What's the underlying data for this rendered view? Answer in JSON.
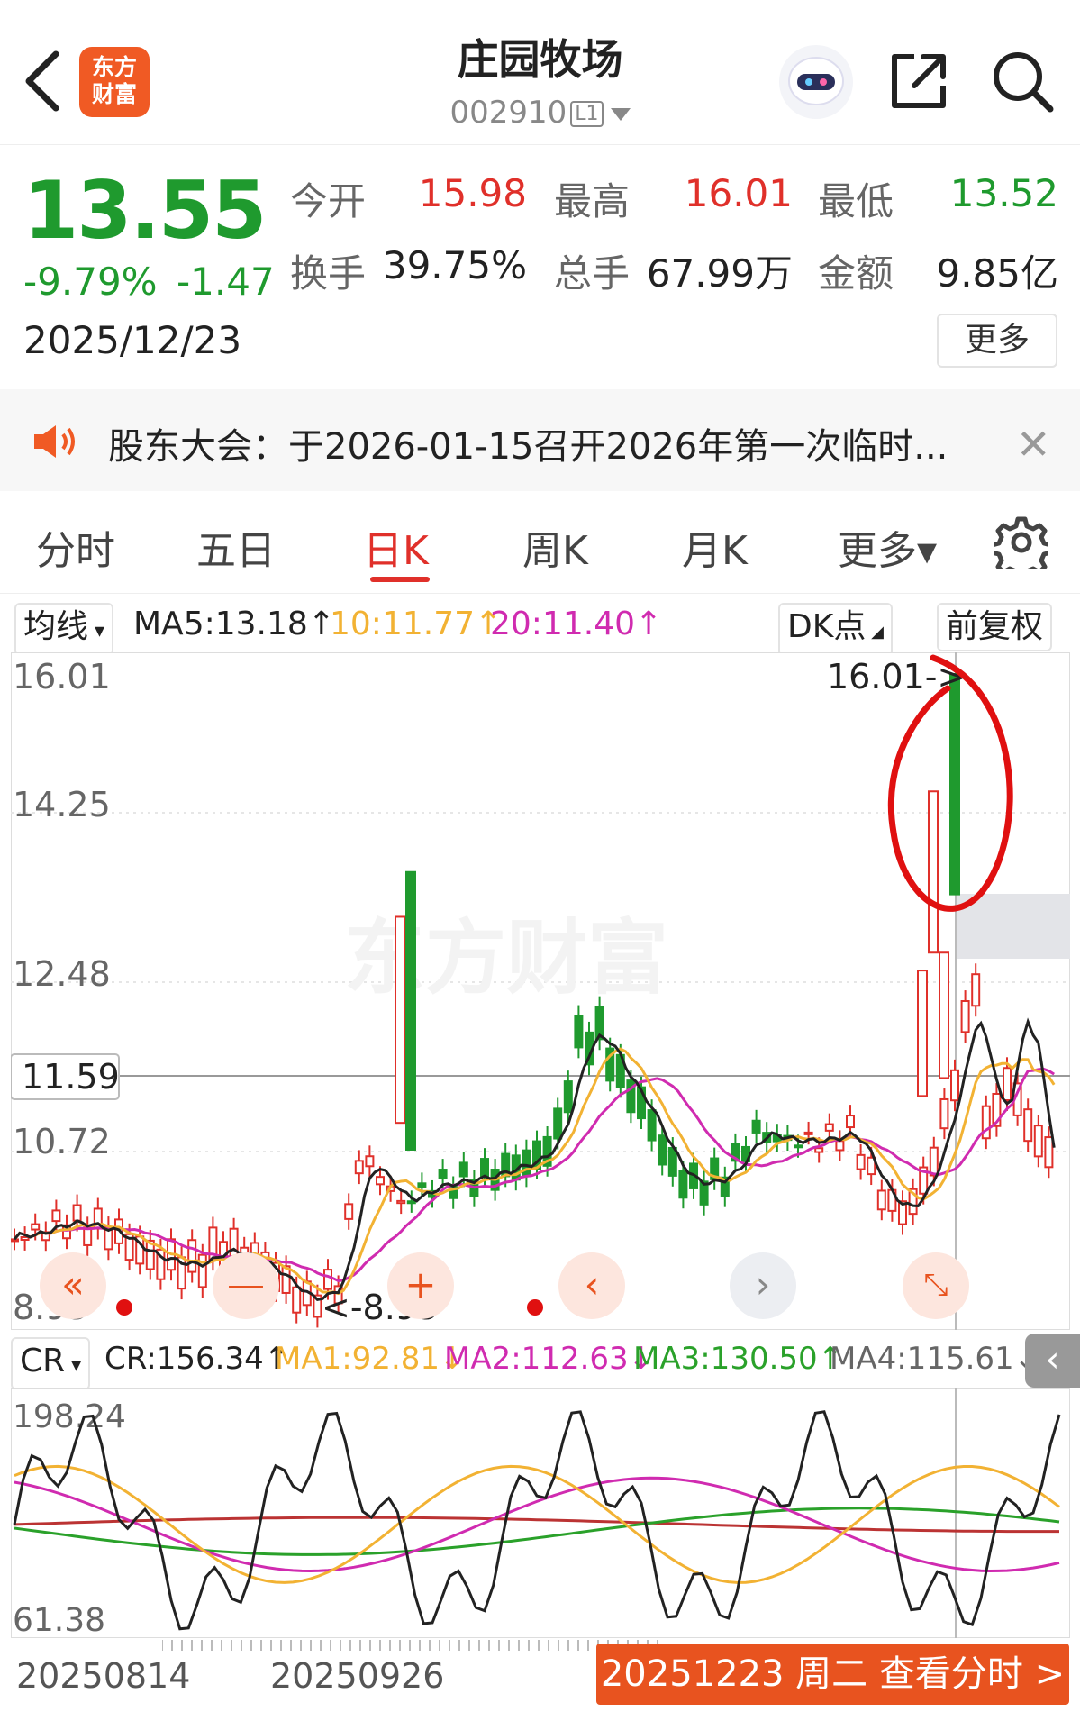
{
  "header": {
    "stock_name": "庄园牧场",
    "stock_code": "002910",
    "level_badge": "L1",
    "logo_text_top": "东方",
    "logo_text_bottom": "财富"
  },
  "quote": {
    "price": "13.55",
    "change_pct": "-9.79%",
    "change_abs": "-1.47",
    "date": "2025/12/23",
    "open_label": "今开",
    "open": "15.98",
    "high_label": "最高",
    "high": "16.01",
    "low_label": "最低",
    "low": "13.52",
    "turnover_label": "换手",
    "turnover": "39.75%",
    "volume_label": "总手",
    "volume": "67.99万",
    "amount_label": "金额",
    "amount": "9.85亿",
    "more_label": "更多"
  },
  "notice": {
    "text": "股东大会：于2026-01-15召开2026年第一次临时..."
  },
  "tabs": [
    "分时",
    "五日",
    "日K",
    "周K",
    "月K",
    "更多▾"
  ],
  "active_tab": "日K",
  "ma_row": {
    "selector": "均线",
    "ma5": "MA5:13.18↑",
    "ma10": "10:11.77↑",
    "ma20": "20:11.40↑",
    "dk_label": "DK点",
    "adjust_label": "前复权"
  },
  "kline": {
    "y_labels": [
      "16.01",
      "14.25",
      "12.48",
      "10.72",
      "8.95"
    ],
    "current_label": "11.59",
    "high_marker": "16.01->",
    "low_marker": "<-8.95",
    "watermark": "东方财富"
  },
  "cr_row": {
    "selector": "CR",
    "cr": "CR:156.34↑",
    "ma1": "MA1:92.81↓",
    "ma2": "MA2:112.63↓",
    "ma3": "MA3:130.50↑",
    "ma4": "MA4:115.61↓",
    "y_top": "198.24",
    "y_bottom": "61.38"
  },
  "bottom": {
    "date_left": "20250814",
    "date_mid": "20250926",
    "view_button": "20251223 周二 查看分时 >"
  },
  "colors": {
    "up": "#e0302a",
    "down": "#1f9a2e",
    "ma5": "#222222",
    "ma10": "#f2b233",
    "ma20": "#d02bb0",
    "accent": "#e8531f"
  },
  "chart_data": {
    "type": "candlestick",
    "ylim": [
      8.95,
      16.01
    ],
    "series": [
      {
        "name": "MA5"
      },
      {
        "name": "MA10"
      },
      {
        "name": "MA20"
      }
    ]
  }
}
